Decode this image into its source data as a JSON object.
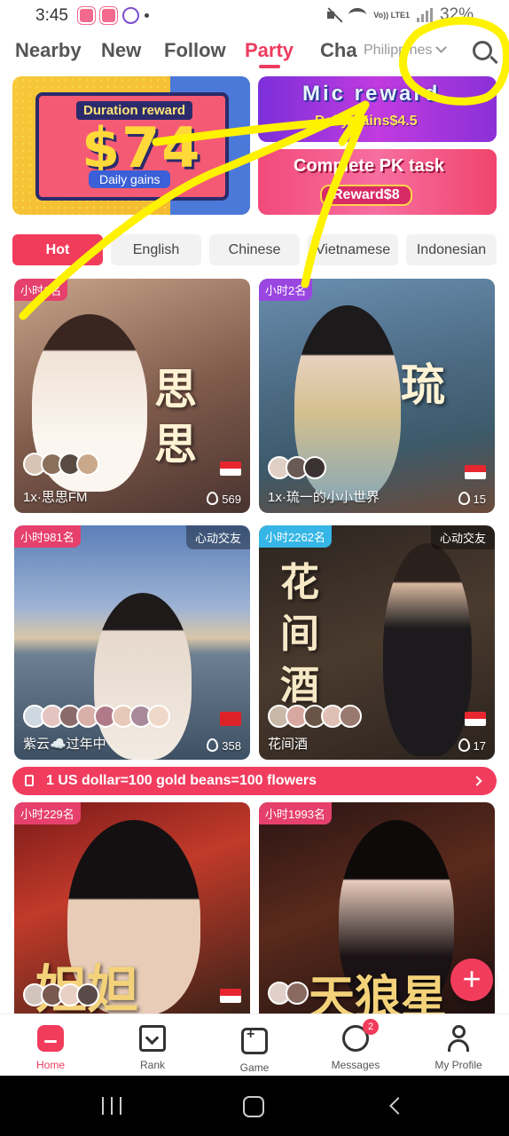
{
  "status_bar": {
    "time": "3:45",
    "volte": "Vo)) LTE1",
    "battery": "32%"
  },
  "top_tabs": [
    {
      "label": "Nearby",
      "active": false
    },
    {
      "label": "New",
      "active": false
    },
    {
      "label": "Follow",
      "active": false
    },
    {
      "label": "Party",
      "active": true
    },
    {
      "label": "Cha",
      "active": false
    }
  ],
  "region_selector": {
    "label": "Philippines"
  },
  "banners": {
    "duration": {
      "header": "Duration reward",
      "amount": "$74",
      "sub": "Daily gains"
    },
    "mic": {
      "title": "Mic reward",
      "sub": "Daily gains$4.5"
    },
    "pk": {
      "title": "Complete PK task",
      "sub": "Reward$8"
    }
  },
  "language_chips": [
    {
      "label": "Hot",
      "active": true
    },
    {
      "label": "English",
      "active": false
    },
    {
      "label": "Chinese",
      "active": false
    },
    {
      "label": "Vietnamese",
      "active": false
    },
    {
      "label": "Indonesian",
      "active": false
    }
  ],
  "rooms": [
    {
      "rank": "小时1名",
      "tag": "",
      "title_art": "思 思",
      "name": "1x·思思FM",
      "count": "569",
      "flag": "sg"
    },
    {
      "rank": "小时2名",
      "tag": "",
      "title_art": "琉",
      "name": "1x·琉一的小小世界",
      "count": "15",
      "flag": "sg"
    },
    {
      "rank": "小时981名",
      "tag": "心动交友",
      "title_art": "",
      "name": "紫云☁️过年中",
      "count": "358",
      "flag": "hk"
    },
    {
      "rank": "小时2262名",
      "tag": "心动交友",
      "title_art": "花 间 酒",
      "name": "花间酒",
      "count": "17",
      "flag": "sg"
    },
    {
      "rank": "小时229名",
      "tag": "",
      "title_art": "妲妲",
      "name": "",
      "count": "",
      "flag": "sg"
    },
    {
      "rank": "小时1993名",
      "tag": "",
      "title_art": "天狼星",
      "name": "",
      "count": "",
      "flag": ""
    }
  ],
  "notice": "1 US dollar=100 gold beans=100 flowers",
  "bottom_nav": [
    {
      "label": "Home",
      "active": true
    },
    {
      "label": "Rank",
      "active": false
    },
    {
      "label": "Game",
      "active": false
    },
    {
      "label": "Messages",
      "active": false,
      "badge": "2"
    },
    {
      "label": "My Profile",
      "active": false
    }
  ],
  "colors": {
    "accent": "#ee3c5f",
    "annotation": "#fff200"
  }
}
